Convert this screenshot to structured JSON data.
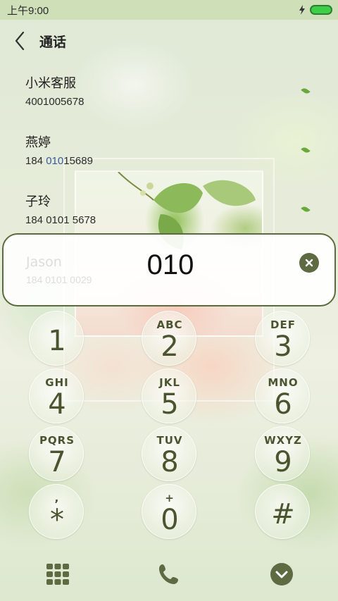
{
  "status_bar": {
    "time": "上午9:00"
  },
  "header": {
    "title": "通话"
  },
  "contacts": [
    {
      "name": "小米客服",
      "number": "4001005678"
    },
    {
      "name": "燕婷",
      "number_pre": "184 ",
      "number_hl": "010",
      "number_post": "15689"
    },
    {
      "name": "子玲",
      "number": "184 0101 5678"
    }
  ],
  "search": {
    "value": "010",
    "ghost_name": "Jason",
    "ghost_number": "184 0101 0029"
  },
  "keypad": [
    {
      "digit": "1",
      "letters": ""
    },
    {
      "digit": "2",
      "letters": "ABC"
    },
    {
      "digit": "3",
      "letters": "DEF"
    },
    {
      "digit": "4",
      "letters": "GHI"
    },
    {
      "digit": "5",
      "letters": "JKL"
    },
    {
      "digit": "6",
      "letters": "MNO"
    },
    {
      "digit": "7",
      "letters": "PQRS"
    },
    {
      "digit": "8",
      "letters": "TUV"
    },
    {
      "digit": "9",
      "letters": "WXYZ"
    },
    {
      "digit": "*",
      "letters": ","
    },
    {
      "digit": "0",
      "letters": "+"
    },
    {
      "digit": "#",
      "letters": ""
    }
  ],
  "colors": {
    "accent": "#5d6a42",
    "status_bar": "#cfe0b9",
    "battery": "#3ecf4a",
    "highlight": "#3b5998"
  },
  "icons": [
    "back-arrow-icon",
    "charging-bolt-icon",
    "battery-icon",
    "clear-icon",
    "dialpad-grid-icon",
    "phone-icon",
    "collapse-chevron-icon"
  ]
}
